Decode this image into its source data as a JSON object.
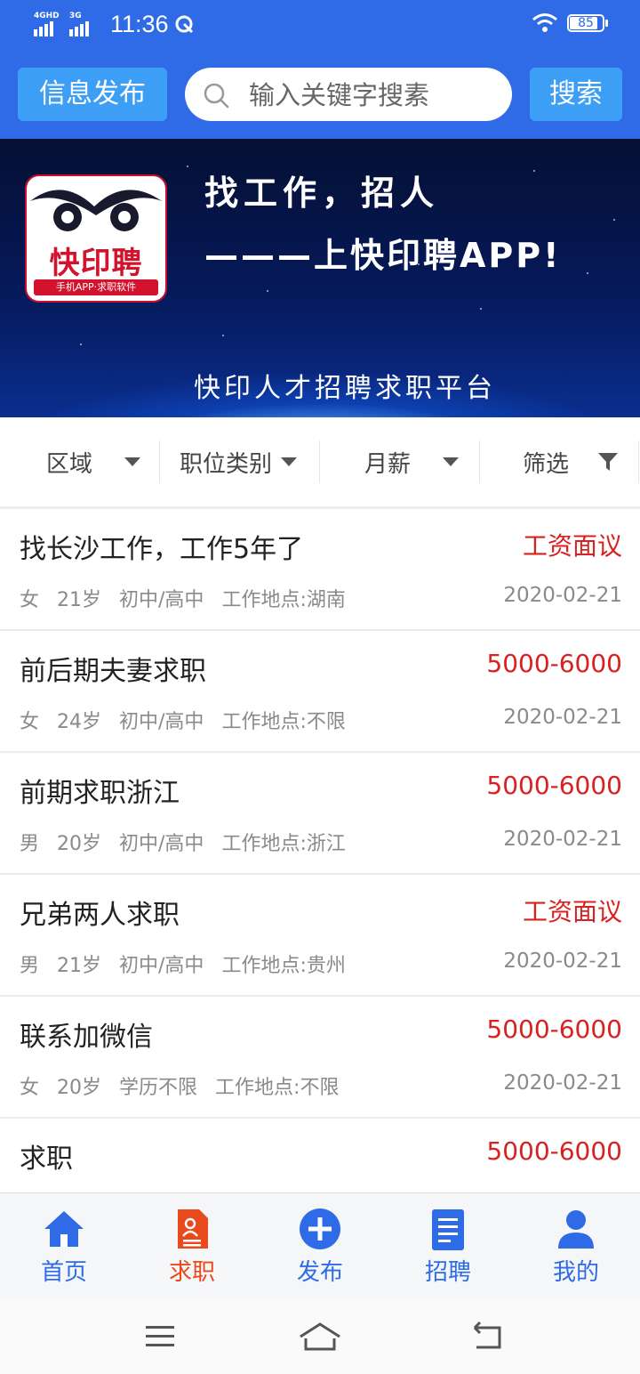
{
  "status_bar": {
    "network_1": "4GHD",
    "network_2": "3G",
    "time": "11:36",
    "battery": "85"
  },
  "header": {
    "post_button": "信息发布",
    "search_placeholder": "输入关键字搜素",
    "search_button": "搜索"
  },
  "banner": {
    "logo_text": "快印聘",
    "logo_sub": "手机APP·求职软件",
    "headline_1": "找工作，招人",
    "headline_2": "———上快印聘APP!",
    "tagline": "快印人才招聘求职平台"
  },
  "filters": [
    {
      "label": "区域"
    },
    {
      "label": "职位类别"
    },
    {
      "label": "月薪"
    },
    {
      "label": "筛选"
    }
  ],
  "listings": [
    {
      "title": "找长沙工作，工作5年了",
      "salary": "工资面议",
      "gender": "女",
      "age": "21岁",
      "education": "初中/高中",
      "location": "工作地点:湖南",
      "date": "2020-02-21"
    },
    {
      "title": "前后期夫妻求职",
      "salary": "5000-6000",
      "gender": "女",
      "age": "24岁",
      "education": "初中/高中",
      "location": "工作地点:不限",
      "date": "2020-02-21"
    },
    {
      "title": "前期求职浙江",
      "salary": "5000-6000",
      "gender": "男",
      "age": "20岁",
      "education": "初中/高中",
      "location": "工作地点:浙江",
      "date": "2020-02-21"
    },
    {
      "title": "兄弟两人求职",
      "salary": "工资面议",
      "gender": "男",
      "age": "21岁",
      "education": "初中/高中",
      "location": "工作地点:贵州",
      "date": "2020-02-21"
    },
    {
      "title": "联系加微信",
      "salary": "5000-6000",
      "gender": "女",
      "age": "20岁",
      "education": "学历不限",
      "location": "工作地点:不限",
      "date": "2020-02-21"
    },
    {
      "title": "求职",
      "salary": "5000-6000",
      "gender": "",
      "age": "",
      "education": "",
      "location": "",
      "date": ""
    }
  ],
  "tabs": [
    {
      "label": "首页",
      "icon": "home-icon"
    },
    {
      "label": "求职",
      "icon": "resume-icon",
      "active": true
    },
    {
      "label": "发布",
      "icon": "plus-circle-icon"
    },
    {
      "label": "招聘",
      "icon": "document-icon"
    },
    {
      "label": "我的",
      "icon": "user-icon"
    }
  ],
  "colors": {
    "primary": "#2f6be6",
    "button": "#3d9ef5",
    "salary": "#d92121",
    "active_tab": "#e8491d"
  }
}
